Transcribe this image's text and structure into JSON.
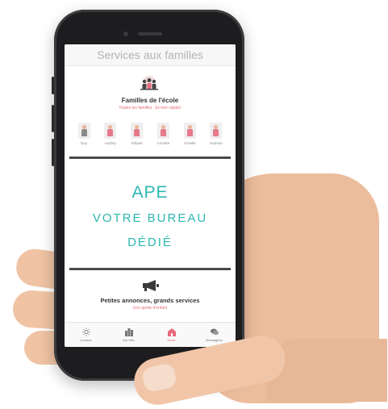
{
  "topbar": {
    "title": "Services aux familles"
  },
  "families_card": {
    "title": "Familles de l'école",
    "subtitle": "Toutes les familles · En lien rapide!",
    "people": [
      {
        "name": "Guy"
      },
      {
        "name": "Audrey"
      },
      {
        "name": "Sihane"
      },
      {
        "name": "Annette"
      },
      {
        "name": "Armelle"
      },
      {
        "name": "Noémie"
      }
    ]
  },
  "ape_card": {
    "line1": "APE",
    "line2": "VOTRE BUREAU",
    "line3": "DÉDIÉ"
  },
  "ads_card": {
    "title": "Petites annonces, grands services",
    "subtitle": "Une garde d'enfant"
  },
  "tabbar": {
    "tabs": [
      {
        "label": "Journée",
        "icon": "sun-icon"
      },
      {
        "label": "Ma Ville",
        "icon": "city-icon"
      },
      {
        "label": "École",
        "icon": "school-icon"
      },
      {
        "label": "Messagerie",
        "icon": "chat-icon"
      }
    ]
  },
  "colors": {
    "accent_teal": "#2cb8b0",
    "accent_pink": "#e56b7d"
  }
}
